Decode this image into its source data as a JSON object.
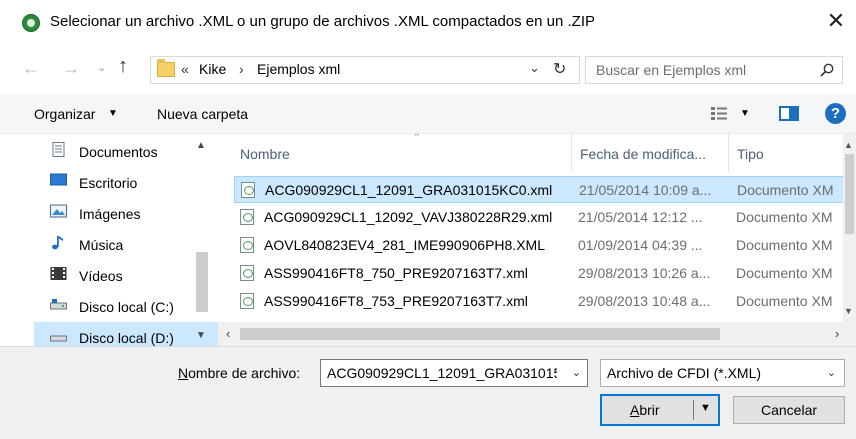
{
  "window": {
    "title": "Selecionar un archivo .XML o un grupo de archivos .XML compactados en un .ZIP",
    "close": "✕"
  },
  "nav": {
    "back": "←",
    "forward": "→",
    "recent": "⌄",
    "up": "↑",
    "address_chevron": "«",
    "address_segments": [
      "Kike",
      "Ejemplos xml"
    ],
    "address_separator": "›",
    "address_dropdown": "⌄",
    "refresh": "↻",
    "search_placeholder": "Buscar en Ejemplos xml"
  },
  "toolbar": {
    "organize": "Organizar",
    "new_folder": "Nueva carpeta",
    "help": "?"
  },
  "sidebar": {
    "items": [
      {
        "label": "Documentos",
        "icon": "documents-icon"
      },
      {
        "label": "Escritorio",
        "icon": "desktop-icon"
      },
      {
        "label": "Imágenes",
        "icon": "pictures-icon"
      },
      {
        "label": "Música",
        "icon": "music-icon"
      },
      {
        "label": "Vídeos",
        "icon": "videos-icon"
      },
      {
        "label": "Disco local (C:)",
        "icon": "drive-icon"
      },
      {
        "label": "Disco local (D:)",
        "icon": "drive-icon",
        "selected": true
      }
    ]
  },
  "files": {
    "columns": [
      "Nombre",
      "Fecha de modifica...",
      "Tipo"
    ],
    "rows": [
      {
        "name": "ACG090929CL1_12091_GRA031015KC0.xml",
        "date": "21/05/2014 10:09 a...",
        "type": "Documento XM",
        "selected": true
      },
      {
        "name": "ACG090929CL1_12092_VAVJ380228R29.xml",
        "date": "21/05/2014 12:12 ...",
        "type": "Documento XM"
      },
      {
        "name": "AOVL840823EV4_281_IME990906PH8.XML",
        "date": "01/09/2014 04:39 ...",
        "type": "Documento XM"
      },
      {
        "name": "ASS990416FT8_750_PRE9207163T7.xml",
        "date": "29/08/2013 10:26 a...",
        "type": "Documento XM"
      },
      {
        "name": "ASS990416FT8_753_PRE9207163T7.xml",
        "date": "29/08/2013 10:48 a...",
        "type": "Documento XM"
      }
    ]
  },
  "bottom": {
    "filename_label": "Nombre de archivo:",
    "filename_value": "ACG090929CL1_12091_GRA031015",
    "filetype": "Archivo de CFDI (*.XML)",
    "open": "Abrir",
    "cancel": "Cancelar"
  },
  "colors": {
    "accent": "#0078d7",
    "selection": "#cce8ff"
  }
}
